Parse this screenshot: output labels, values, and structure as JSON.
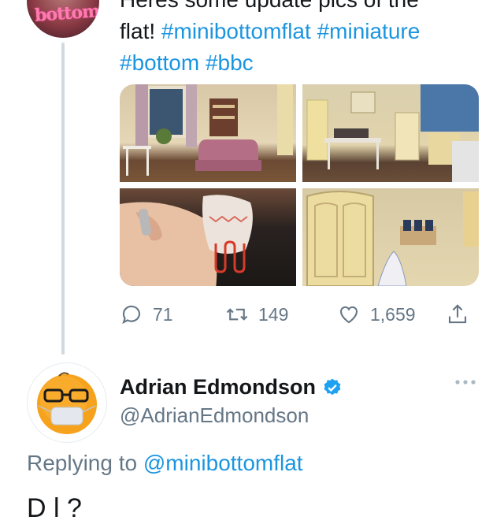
{
  "tweet": {
    "text_line1": "Heres some update pics of the",
    "text_line2_prefix": "flat! ",
    "hashtags_line2": [
      "#minibottomflat",
      "#miniature"
    ],
    "hashtags_line3": [
      "#bottom",
      "#bbc"
    ],
    "avatar_logo_text": "bottom",
    "reply_count": "71",
    "retweet_count": "149",
    "like_count": "1,659"
  },
  "reply_tweet": {
    "display_name": "Adrian Edmondson",
    "handle": "@AdrianEdmondson",
    "replying_prefix": "Replying to ",
    "replying_to": "@minibottomflat",
    "partial_next_text": "D                              l ?"
  },
  "colors": {
    "link": "#1b95e0",
    "secondary_text": "#657786",
    "verified": "#1da1f2",
    "thread_line": "#cfd9de"
  },
  "icons": [
    "reply-icon",
    "retweet-icon",
    "like-icon",
    "share-icon",
    "verified-icon",
    "more-icon"
  ]
}
